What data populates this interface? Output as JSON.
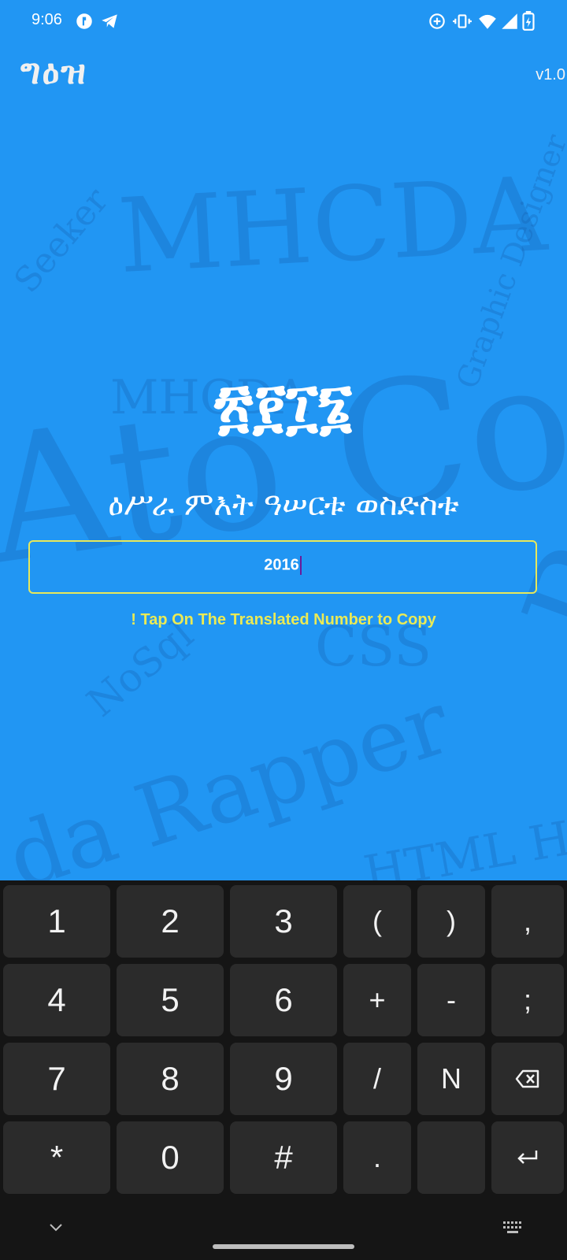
{
  "status_bar": {
    "time": "9:06",
    "icons": [
      "app-icon",
      "telegram-icon",
      "data-saver-icon",
      "vibrate-icon",
      "wifi-icon",
      "signal-icon",
      "battery-icon"
    ]
  },
  "header": {
    "app_logo": "ግዕዝ",
    "version": "v1.0"
  },
  "result": {
    "ethiopic_number": "፳፻፲፮",
    "words": "ዕሥራ ምእት ዓሠርቱ ወስድስቱ"
  },
  "input": {
    "value": "2016"
  },
  "hint": "! Tap On The Translated Number to Copy",
  "keyboard": {
    "rows": [
      [
        "1",
        "2",
        "3",
        "(",
        ")",
        ","
      ],
      [
        "4",
        "5",
        "6",
        "+",
        "-",
        ";"
      ],
      [
        "7",
        "8",
        "9",
        "/",
        "N",
        "backspace-icon"
      ],
      [
        "*",
        "0",
        "#",
        ".",
        "",
        "enter-icon"
      ]
    ]
  },
  "colors": {
    "background": "#2196F3",
    "accent": "#EAEA55",
    "keyboard_bg": "#151515",
    "key_bg": "#2B2B2B"
  }
}
